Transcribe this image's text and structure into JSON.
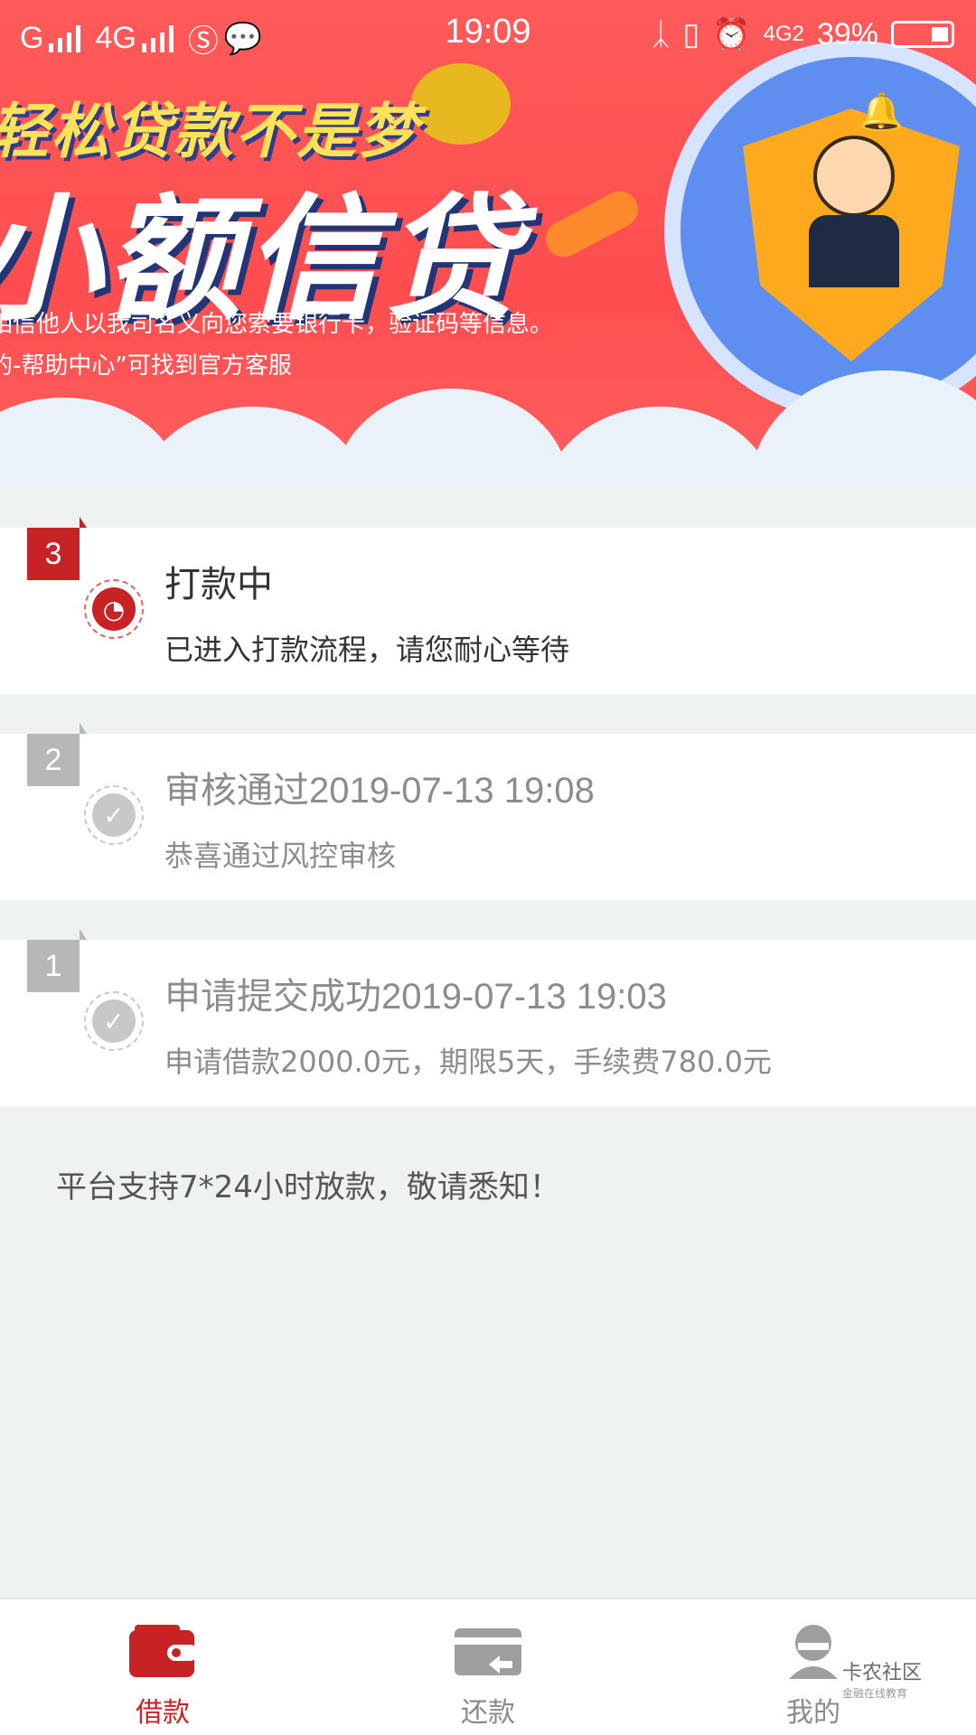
{
  "status_bar": {
    "carrier1": "G",
    "net1": "4G",
    "time": "19:09",
    "net2": "4G2",
    "battery": "39%"
  },
  "banner": {
    "tagline": "轻松贷款不是梦",
    "title": "小额信贷",
    "note1": "相信他人以我司名义向您索要银行卡，验证码等信息。",
    "note2": "的-帮助中心”可找到官方客服"
  },
  "steps": [
    {
      "number": "3",
      "title": "打款中",
      "desc": "已进入打款流程，请您耐心等待",
      "state": "active"
    },
    {
      "number": "2",
      "title": "审核通过2019-07-13 19:08",
      "desc": "恭喜通过风控审核",
      "state": "done"
    },
    {
      "number": "1",
      "title": "申请提交成功2019-07-13 19:03",
      "desc": "申请借款2000.0元，期限5天，手续费780.0元",
      "state": "done"
    }
  ],
  "notice": "平台支持7*24小时放款，敬请悉知！",
  "tabs": [
    {
      "label": "借款",
      "icon": "wallet-icon",
      "active": true
    },
    {
      "label": "还款",
      "icon": "repay-card-icon",
      "active": false
    },
    {
      "label": "我的",
      "icon": "profile-icon",
      "active": false
    }
  ],
  "watermark": {
    "text": "卡农社区",
    "sub": "金融在线教育"
  },
  "colors": {
    "accent": "#c72224",
    "inactive": "#b7b7b7",
    "background": "#eef2f3"
  }
}
